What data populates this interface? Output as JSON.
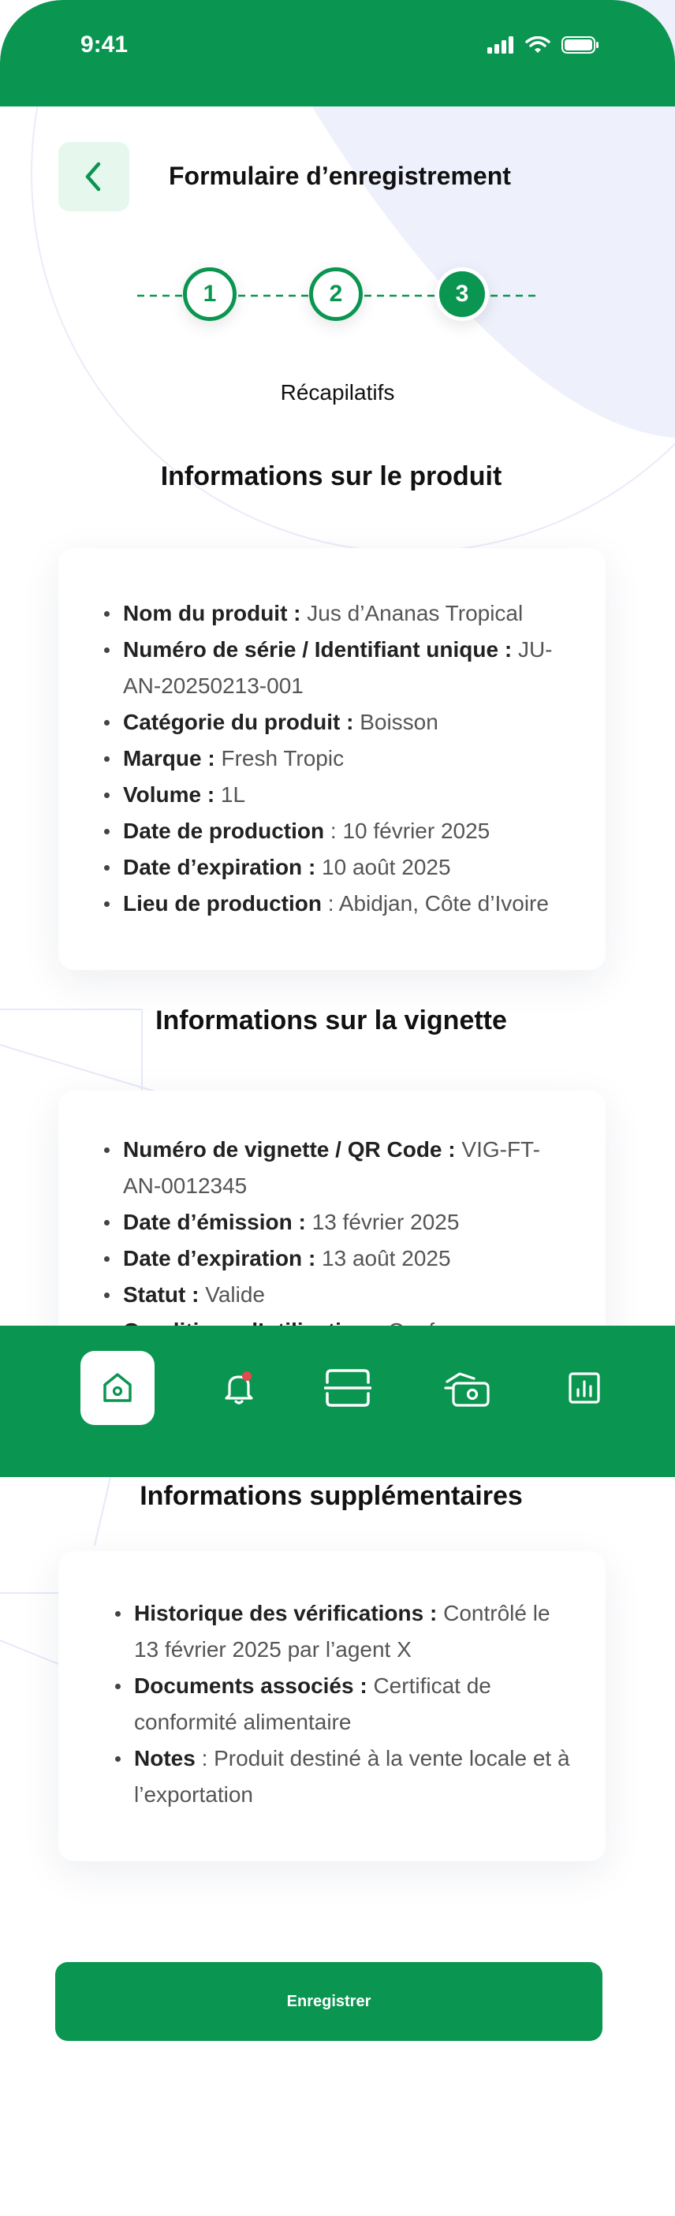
{
  "status_bar": {
    "time": "9:41"
  },
  "header": {
    "title": "Formulaire d’enregistrement"
  },
  "stepper": {
    "steps": [
      "1",
      "2",
      "3"
    ],
    "current_label": "Récapilatifs"
  },
  "product": {
    "title": "Informations sur le produit",
    "items": [
      {
        "label": "Nom du produit :",
        "value": " Jus d’Ananas Tropical"
      },
      {
        "label": "Numéro de série / Identifiant unique :",
        "value": " JU-AN-20250213-001"
      },
      {
        "label": "Catégorie du produit :",
        "value": " Boisson"
      },
      {
        "label": "Marque :",
        "value": " Fresh Tropic"
      },
      {
        "label": "Volume :",
        "value": " 1L"
      },
      {
        "label": "Date de production",
        "value": " : 10 février 2025"
      },
      {
        "label": "Date d’expiration :",
        "value": " 10 août 2025"
      },
      {
        "label": "Lieu de production",
        "value": " : Abidjan, Côte d’Ivoire"
      }
    ]
  },
  "vignette": {
    "title": "Informations sur la vignette",
    "items": [
      {
        "label": "Numéro de vignette / QR Code :",
        "value": " VIG-FT-AN-0012345"
      },
      {
        "label": "Date d’émission :",
        "value": " 13 février 2025"
      },
      {
        "label": "Date d’expiration :",
        "value": " 13 août 2025"
      },
      {
        "label": "Statut :",
        "value": " Valide"
      },
      {
        "label": "Conditions d’utilisation :",
        "value": " Conf..."
      }
    ]
  },
  "supplementary": {
    "title": "Informations supplémentaires",
    "items": [
      {
        "label": "Historique des vérifications :",
        "value": " Contrôlé le 13 février 2025 par l’agent X"
      },
      {
        "label": "Documents associés :",
        "value": " Certificat de conformité alimentaire"
      },
      {
        "label": "Notes",
        "value": " : Produit destiné à la vente locale et à l’exportation"
      }
    ]
  },
  "bottom_nav": {
    "items": [
      "home-icon",
      "bell-icon",
      "scanner-icon",
      "payment-icon",
      "report-icon"
    ],
    "active": "home-icon",
    "notification_color": "#e5484d"
  },
  "actions": {
    "save_label": "Enregistrer"
  },
  "colors": {
    "primary": "#0a9550",
    "primary_light": "#e6f7ee"
  }
}
